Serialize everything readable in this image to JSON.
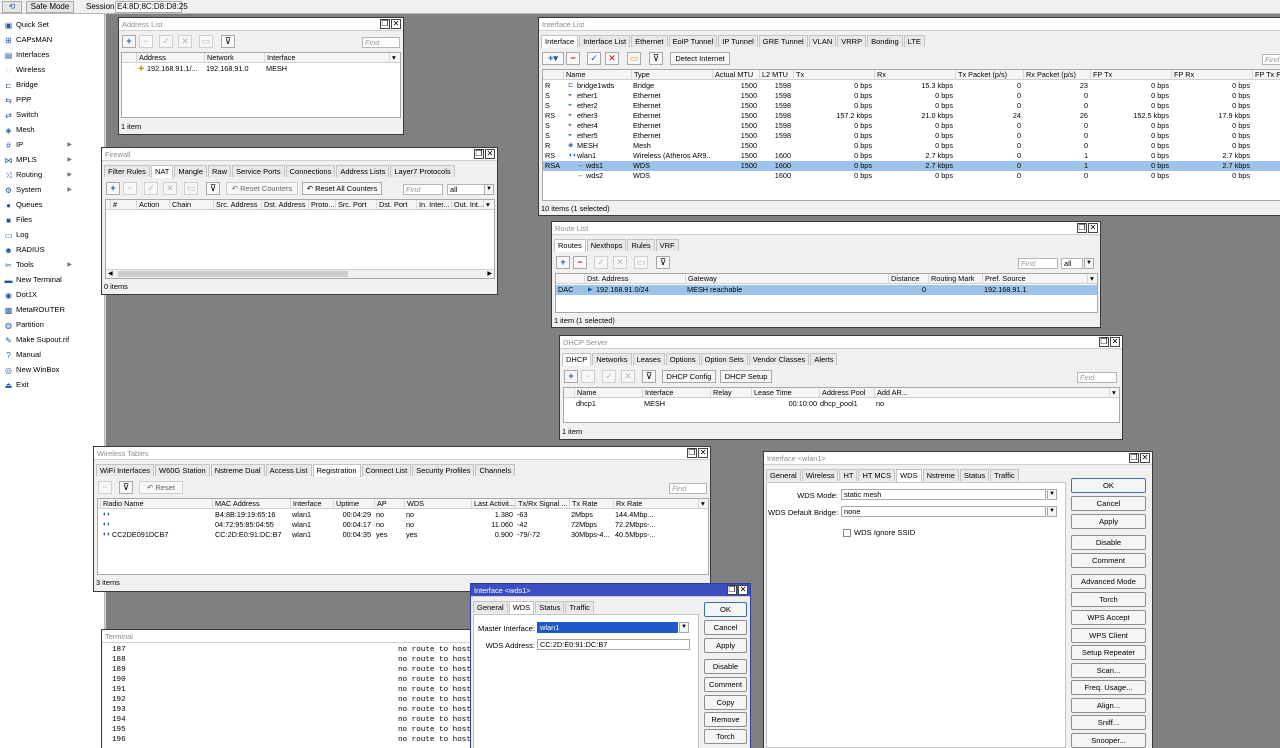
{
  "topbar": {
    "safe_mode": "Safe Mode",
    "session_label": "Session:",
    "session_value": "E4:8D:8C:D8:D8:25"
  },
  "menu": [
    "Quick Set",
    "CAPsMAN",
    "Interfaces",
    "Wireless",
    "Bridge",
    "PPP",
    "Switch",
    "Mesh",
    "IP",
    "MPLS",
    "Routing",
    "System",
    "Queues",
    "Files",
    "Log",
    "RADIUS",
    "Tools",
    "New Terminal",
    "Dot1X",
    "MetaROUTER",
    "Partition",
    "Make Supout.rif",
    "Manual",
    "New WinBox",
    "Exit"
  ],
  "address_list": {
    "title": "Address List",
    "find": "Find",
    "cols": [
      "Address",
      "Network",
      "Interface"
    ],
    "rows": [
      [
        "192.168.91.1/...",
        "192.168.91.0",
        "MESH"
      ]
    ],
    "status": "1 item"
  },
  "firewall": {
    "title": "Firewall",
    "tabs": [
      "Filter Rules",
      "NAT",
      "Mangle",
      "Raw",
      "Service Ports",
      "Connections",
      "Address Lists",
      "Layer7 Protocols"
    ],
    "reset_counters": "Reset Counters",
    "reset_all": "Reset All Counters",
    "find": "Find",
    "filter": "all",
    "cols": [
      "#",
      "Action",
      "Chain",
      "Src. Address",
      "Dst. Address",
      "Proto...",
      "Src. Port",
      "Dst. Port",
      "In. Inter...",
      "Out. Int..."
    ],
    "status": "0 items"
  },
  "interface_list": {
    "title": "Interface List",
    "tabs": [
      "Interface",
      "Interface List",
      "Ethernet",
      "EoIP Tunnel",
      "IP Tunnel",
      "GRE Tunnel",
      "VLAN",
      "VRRP",
      "Bonding",
      "LTE"
    ],
    "detect": "Detect Internet",
    "find": "Find",
    "cols": [
      "Name",
      "Type",
      "Actual MTU",
      "L2 MTU",
      "Tx",
      "Rx",
      "Tx Packet (p/s)",
      "Rx Packet (p/s)",
      "FP Tx",
      "FP Rx",
      "FP Tx P"
    ],
    "rows": [
      [
        "R",
        "bridge1wds",
        "Bridge",
        "1500",
        "1598",
        "0 bps",
        "15.3 kbps",
        "0",
        "23",
        "0 bps",
        "0 bps"
      ],
      [
        "S",
        "ether1",
        "Ethernet",
        "1500",
        "1598",
        "0 bps",
        "0 bps",
        "0",
        "0",
        "0 bps",
        "0 bps"
      ],
      [
        "S",
        "ether2",
        "Ethernet",
        "1500",
        "1598",
        "0 bps",
        "0 bps",
        "0",
        "0",
        "0 bps",
        "0 bps"
      ],
      [
        "RS",
        "ether3",
        "Ethernet",
        "1500",
        "1598",
        "157.2 kbps",
        "21.0 kbps",
        "24",
        "26",
        "152.5 kbps",
        "17.9 kbps"
      ],
      [
        "S",
        "ether4",
        "Ethernet",
        "1500",
        "1598",
        "0 bps",
        "0 bps",
        "0",
        "0",
        "0 bps",
        "0 bps"
      ],
      [
        "S",
        "ether5",
        "Ethernet",
        "1500",
        "1598",
        "0 bps",
        "0 bps",
        "0",
        "0",
        "0 bps",
        "0 bps"
      ],
      [
        "R",
        "MESH",
        "Mesh",
        "1500",
        "",
        "0 bps",
        "0 bps",
        "0",
        "0",
        "0 bps",
        "0 bps"
      ],
      [
        "RS",
        "wlan1",
        "Wireless (Atheros AR9...",
        "1500",
        "1600",
        "0 bps",
        "2.7 kbps",
        "0",
        "1",
        "0 bps",
        "2.7 kbps"
      ],
      [
        "RSA",
        "wds1",
        "WDS",
        "1500",
        "1600",
        "0 bps",
        "2.7 kbps",
        "0",
        "1",
        "0 bps",
        "2.7 kbps"
      ],
      [
        "",
        "wds2",
        "WDS",
        "",
        "1600",
        "0 bps",
        "0 bps",
        "0",
        "0",
        "0 bps",
        "0 bps"
      ]
    ],
    "status": "10 items (1 selected)"
  },
  "route_list": {
    "title": "Route List",
    "tabs": [
      "Routes",
      "Nexthops",
      "Rules",
      "VRF"
    ],
    "find": "Find",
    "filter": "all",
    "cols": [
      "Dst. Address",
      "Gateway",
      "Distance",
      "Routing Mark",
      "Pref. Source"
    ],
    "rows": [
      [
        "DAC",
        "192.168.91.0/24",
        "MESH reachable",
        "0",
        "",
        "192.168.91.1"
      ]
    ],
    "status": "1 item (1 selected)"
  },
  "dhcp": {
    "title": "DHCP Server",
    "tabs": [
      "DHCP",
      "Networks",
      "Leases",
      "Options",
      "Option Sets",
      "Vendor Classes",
      "Alerts"
    ],
    "config": "DHCP Config",
    "setup": "DHCP Setup",
    "find": "Find",
    "cols": [
      "Name",
      "Interface",
      "Relay",
      "Lease Time",
      "Address Pool",
      "Add AR..."
    ],
    "rows": [
      [
        "dhcp1",
        "MESH",
        "",
        "00:10:00",
        "dhcp_pool1",
        "no"
      ]
    ],
    "status": "1 item"
  },
  "wireless": {
    "title": "Wireless Tables",
    "tabs": [
      "WiFi Interfaces",
      "W60G Station",
      "Nstreme Dual",
      "Access List",
      "Registration",
      "Connect List",
      "Security Profiles",
      "Channels"
    ],
    "reset": "Reset",
    "find": "Find",
    "cols": [
      "Radio Name",
      "MAC Address",
      "Interface",
      "Uptime",
      "AP",
      "WDS",
      "Last Activit...",
      "Tx/Rx Signal ...",
      "Tx Rate",
      "Rx Rate"
    ],
    "rows": [
      [
        "",
        "B4:8B:19:19:65:16",
        "wlan1",
        "00:04:29",
        "no",
        "no",
        "1.380",
        "-63",
        "2Mbps",
        "144.4Mbp..."
      ],
      [
        "",
        "04:72:95:85:04:55",
        "wlan1",
        "00:04:17",
        "no",
        "no",
        "11.060",
        "-42",
        "72Mbps",
        "72.2Mbps-..."
      ],
      [
        "CC2DE091DCB7",
        "CC:2D:E0:91:DC:B7",
        "wlan1",
        "00:04:35",
        "yes",
        "yes",
        "0.900",
        "-79/-72",
        "30Mbps-4...",
        "40.5Mbps-..."
      ]
    ],
    "status": "3 items"
  },
  "terminal": {
    "title": "Terminal",
    "lines": [
      [
        "187",
        "no route to host"
      ],
      [
        "188",
        "no route to host"
      ],
      [
        "189",
        "no route to host"
      ],
      [
        "190",
        "no route to host"
      ],
      [
        "191",
        "no route to host"
      ],
      [
        "192",
        "no route to host"
      ],
      [
        "193",
        "no route to host"
      ],
      [
        "194",
        "no route to host"
      ],
      [
        "195",
        "no route to host"
      ],
      [
        "196",
        "no route to host"
      ]
    ]
  },
  "wds1": {
    "title": "Interface <wds1>",
    "tabs": [
      "General",
      "WDS",
      "Status",
      "Traffic"
    ],
    "master_label": "Master Interface:",
    "master_value": "wlan1",
    "wds_addr_label": "WDS Address:",
    "wds_addr_value": "CC:2D:E0:91:DC:B7",
    "buttons": [
      "OK",
      "Cancel",
      "Apply",
      "Disable",
      "Comment",
      "Copy",
      "Remove",
      "Torch"
    ]
  },
  "wlan1": {
    "title": "Interface <wlan1>",
    "tabs": [
      "General",
      "Wireless",
      "HT",
      "HT MCS",
      "WDS",
      "Nstreme",
      "Status",
      "Traffic"
    ],
    "mode_label": "WDS Mode:",
    "mode_value": "static mesh",
    "bridge_label": "WDS Default Bridge:",
    "bridge_value": "none",
    "ignore_ssid": "WDS Ignore SSID",
    "buttons": [
      "OK",
      "Cancel",
      "Apply",
      "Disable",
      "Comment",
      "Advanced Mode",
      "Torch",
      "WPS Accept",
      "WPS Client",
      "Setup Repeater",
      "Scan...",
      "Freq. Usage...",
      "Align...",
      "Sniff...",
      "Snooper..."
    ]
  }
}
